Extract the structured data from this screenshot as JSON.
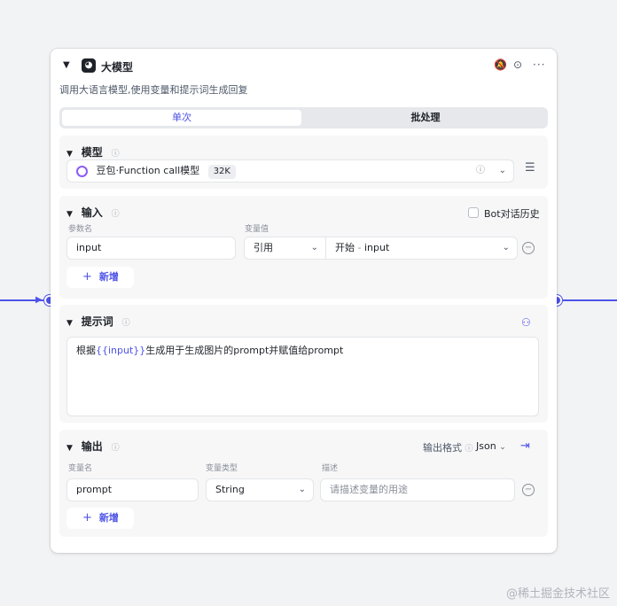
{
  "node": {
    "title": "大模型",
    "description": "调用大语言模型,使用变量和提示词生成回复",
    "icons": [
      "bell-off-icon",
      "play-icon",
      "more-icon"
    ]
  },
  "tabs": [
    {
      "label": "单次",
      "active": true
    },
    {
      "label": "批处理",
      "active": false
    }
  ],
  "model_section": {
    "title": "模型",
    "model_name": "豆包·Function call模型",
    "context": "32K"
  },
  "input_section": {
    "title": "输入",
    "bot_history_label": "Bot对话历史",
    "param_name_header": "参数名",
    "var_value_header": "变量值",
    "rows": [
      {
        "name": "input",
        "type": "引用",
        "ref_source": "开始",
        "ref_sep": "-",
        "ref_var": "input"
      }
    ],
    "add_label": "新增"
  },
  "prompt_section": {
    "title": "提示词",
    "text_before": "根据",
    "variable": "{{input}}",
    "text_after": "生成用于生成图片的prompt并赋值给prompt"
  },
  "output_section": {
    "title": "输出",
    "format_label": "输出格式",
    "format_value": "Json",
    "var_name_header": "变量名",
    "var_type_header": "变量类型",
    "desc_header": "描述",
    "rows": [
      {
        "name": "prompt",
        "type": "String",
        "desc_placeholder": "请描述变量的用途"
      }
    ],
    "add_label": "新增"
  },
  "watermark": "@稀土掘金技术社区",
  "colors": {
    "accent": "#4d53e8",
    "background": "#f2f3f5"
  }
}
